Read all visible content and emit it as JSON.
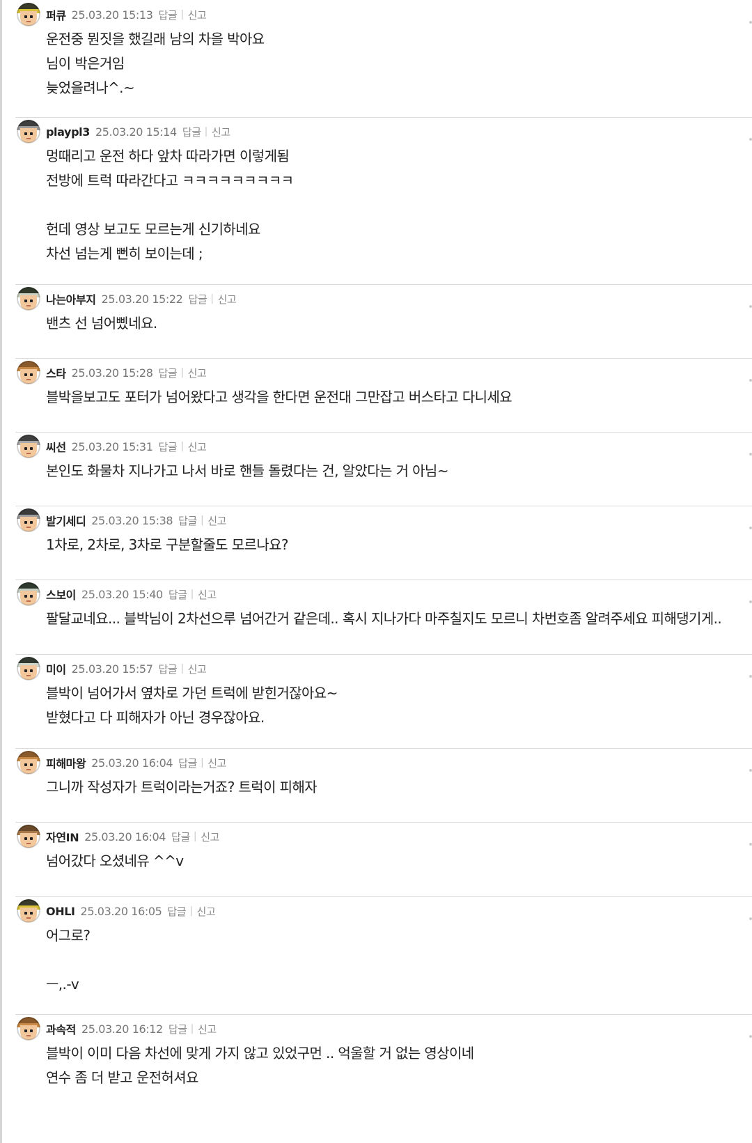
{
  "comments": [
    {
      "nick": "퍼큐",
      "date": "25.03.20 15:13",
      "reply_label": "답글",
      "report_label": "신고",
      "avatar_hat": "#3a3a2a",
      "avatar_band": "#d8c23a",
      "lines": [
        "운전중 뭔짓을 했길래 남의 차을 박아요",
        "님이 박은거임",
        "늦었을려나^.~"
      ]
    },
    {
      "nick": "playpl3",
      "date": "25.03.20 15:14",
      "reply_label": "답글",
      "report_label": "신고",
      "avatar_hat": "#3e3e3e",
      "avatar_band": "#9a9a9a",
      "lines": [
        "멍때리고 운전 하다 앞차 따라가면 이렇게됨",
        "전방에 트럭 따라간다고 ㅋㅋㅋㅋㅋㅋㅋㅋㅋ",
        "",
        "헌데 영상 보고도 모르는게 신기하네요",
        "차선 넘는게 뻔히 보이는데 ;"
      ]
    },
    {
      "nick": "나는아부지",
      "date": "25.03.20 15:22",
      "reply_label": "답글",
      "report_label": "신고",
      "avatar_hat": "#2f3a2a",
      "avatar_band": "#c9d2c0",
      "lines": [
        "밴츠 선 넘어삤네요."
      ]
    },
    {
      "nick": "스타",
      "date": "25.03.20 15:28",
      "reply_label": "답글",
      "report_label": "신고",
      "avatar_hat": "#8a5a2b",
      "avatar_band": "#c98a45",
      "lines": [
        "블박을보고도 포터가 넘어왔다고 생각을 한다면 운전대 그만잡고 버스타고 다니세요"
      ]
    },
    {
      "nick": "씨선",
      "date": "25.03.20 15:31",
      "reply_label": "답글",
      "report_label": "신고",
      "avatar_hat": "#404040",
      "avatar_band": "#a8a8a8",
      "lines": [
        "본인도 화물차 지나가고 나서 바로 핸들 돌렸다는 건, 알았다는 거 아님~"
      ]
    },
    {
      "nick": "발기세디",
      "date": "25.03.20 15:38",
      "reply_label": "답글",
      "report_label": "신고",
      "avatar_hat": "#3a3a3a",
      "avatar_band": "#9c9c9c",
      "lines": [
        "1차로, 2차로, 3차로 구분할줄도 모르나요?"
      ]
    },
    {
      "nick": "스보이",
      "date": "25.03.20 15:40",
      "reply_label": "답글",
      "report_label": "신고",
      "avatar_hat": "#2e3a2e",
      "avatar_band": "#c6cfc4",
      "lines": [
        "팔달교네요... 블박님이 2차선으루 넘어간거 같은데.. 혹시 지나가다 마주칠지도 모르니 차번호좀 알려주세요 피해댕기게.."
      ]
    },
    {
      "nick": "미이",
      "date": "25.03.20 15:57",
      "reply_label": "답글",
      "report_label": "신고",
      "avatar_hat": "#303a30",
      "avatar_band": "#cfd6cc",
      "lines": [
        "블박이 넘어가서 옆차로 가던 트럭에 받힌거잖아요~",
        "받혔다고 다 피해자가 아닌 경우잖아요."
      ]
    },
    {
      "nick": "피해마왕",
      "date": "25.03.20 16:04",
      "reply_label": "답글",
      "report_label": "신고",
      "avatar_hat": "#8a5a2b",
      "avatar_band": "#c98a45",
      "lines": [
        "그니까 작성자가 트럭이라는거죠? 트럭이 피해자"
      ]
    },
    {
      "nick": "자연IN",
      "date": "25.03.20 16:04",
      "reply_label": "답글",
      "report_label": "신고",
      "avatar_hat": "#6a4a2a",
      "avatar_band": "#a87a4a",
      "lines": [
        "넘어갔다 오셨네유 ^^v"
      ]
    },
    {
      "nick": "OHLI",
      "date": "25.03.20 16:05",
      "reply_label": "답글",
      "report_label": "신고",
      "avatar_hat": "#3a3a2a",
      "avatar_band": "#d8c23a",
      "lines": [
        "어그로?",
        "",
        "ㅡ,.-v"
      ]
    },
    {
      "nick": "과속적",
      "date": "25.03.20 16:12",
      "reply_label": "답글",
      "report_label": "신고",
      "avatar_hat": "#8a5a2b",
      "avatar_band": "#c98a45",
      "lines": [
        "블박이 이미 다음 차선에 맞게 가지 않고 있었구먼 .. 억울할 거 없는 영상이네",
        "연수 좀 더 받고 운전허셔요"
      ]
    }
  ]
}
